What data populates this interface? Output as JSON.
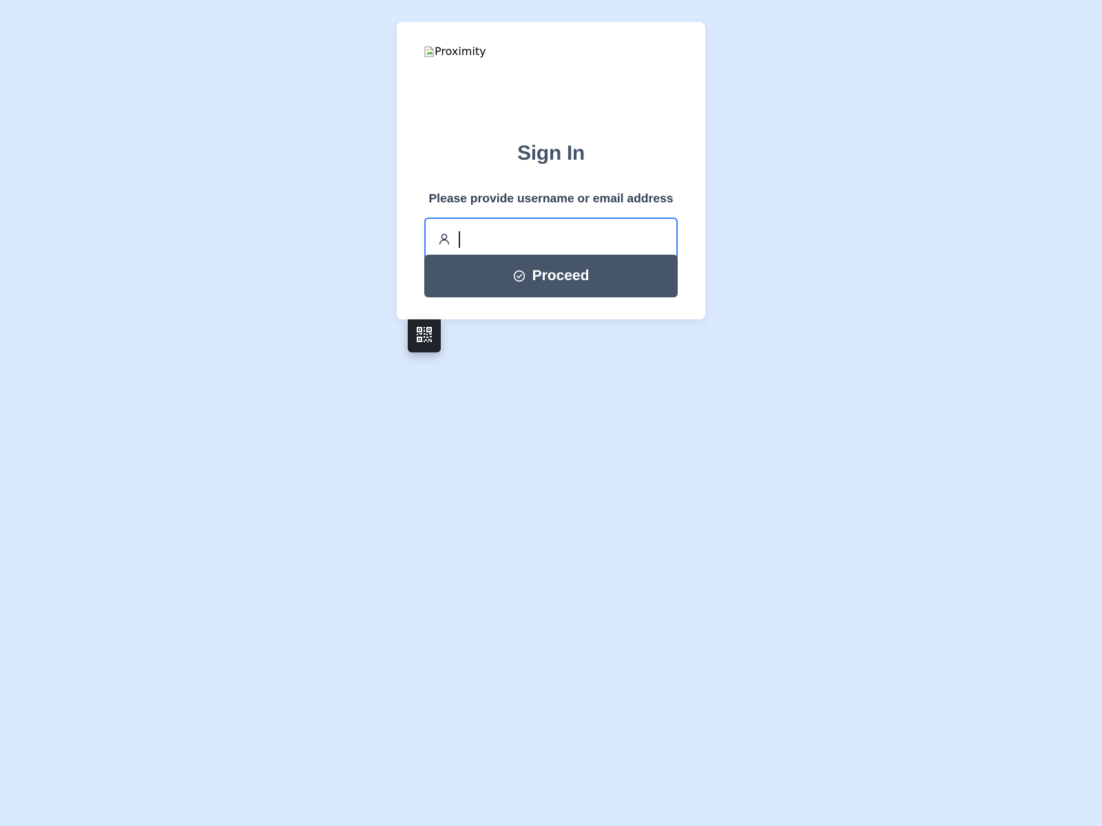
{
  "logo": {
    "alt_text": "Proximity",
    "icon": "broken-image-icon"
  },
  "title": "Sign In",
  "form": {
    "prompt": "Please provide username or email address",
    "username_value": "",
    "username_icon": "user-icon",
    "submit_label": "Proceed",
    "submit_icon": "check-circle-icon"
  },
  "qr_toggle": {
    "icon": "qr-code-icon"
  },
  "colors": {
    "background": "#dbe9fe",
    "card": "#ffffff",
    "title": "#475569",
    "prompt": "#334155",
    "input_border": "#3b82f6",
    "button": "#475569",
    "button_text": "#ffffff",
    "qr_tab": "#1f242b"
  }
}
